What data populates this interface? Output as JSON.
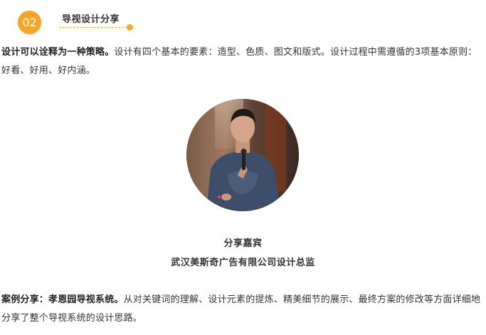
{
  "section": {
    "number": "02",
    "title": "导视设计分享"
  },
  "intro": {
    "lead": "设计可以诠释为一种策略。",
    "body": "设计有四个基本的要素：造型、色质、图文和版式。设计过程中需遵循的3项基本原则：好看、好用、好内涵。"
  },
  "speaker": {
    "label": "分享嘉宾",
    "title": "武汉美斯奇广告有限公司设计总监"
  },
  "case": {
    "lead": "案例分享：孝恩园导视系统。",
    "body": "从对关键词的理解、设计元素的提炼、精美细节的展示、最终方案的修改等方面详细地分享了整个导视系统的设计思路。"
  },
  "colors": {
    "accent": "#f6a623",
    "text": "#333333"
  }
}
